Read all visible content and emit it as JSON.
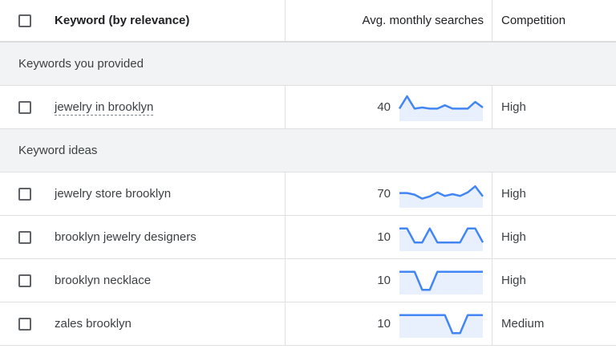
{
  "header": {
    "keyword_col": "Keyword (by relevance)",
    "avg_col": "Avg. monthly searches",
    "competition_col": "Competition"
  },
  "sections": {
    "provided": "Keywords you provided",
    "ideas": "Keyword ideas"
  },
  "rows": [
    {
      "keyword": "jewelry in brooklyn",
      "avg": "40",
      "competition": "High",
      "trend": [
        0.45,
        1.0,
        0.45,
        0.5,
        0.45,
        0.45,
        0.6,
        0.45,
        0.45,
        0.45,
        0.75,
        0.5
      ]
    },
    {
      "keyword": "jewelry store brooklyn",
      "avg": "70",
      "competition": "High",
      "trend": [
        0.55,
        0.55,
        0.48,
        0.3,
        0.4,
        0.58,
        0.42,
        0.5,
        0.42,
        0.58,
        0.85,
        0.4
      ]
    },
    {
      "keyword": "brooklyn jewelry designers",
      "avg": "10",
      "competition": "High",
      "trend": [
        0.9,
        0.9,
        0.28,
        0.28,
        0.9,
        0.28,
        0.28,
        0.28,
        0.28,
        0.9,
        0.9,
        0.28
      ]
    },
    {
      "keyword": "brooklyn necklace",
      "avg": "10",
      "competition": "High",
      "trend": [
        0.9,
        0.9,
        0.9,
        0.1,
        0.1,
        0.9,
        0.9,
        0.9,
        0.9,
        0.9,
        0.9,
        0.9
      ]
    },
    {
      "keyword": "zales brooklyn",
      "avg": "10",
      "competition": "Medium",
      "trend": [
        0.9,
        0.9,
        0.9,
        0.9,
        0.9,
        0.9,
        0.9,
        0.1,
        0.1,
        0.9,
        0.9,
        0.9
      ]
    }
  ],
  "colors": {
    "spark_line": "#4285f4",
    "spark_fill": "#e8f0fe"
  },
  "icons": {
    "checkbox": "checkbox-icon",
    "sparkline": "trend-sparkline"
  }
}
